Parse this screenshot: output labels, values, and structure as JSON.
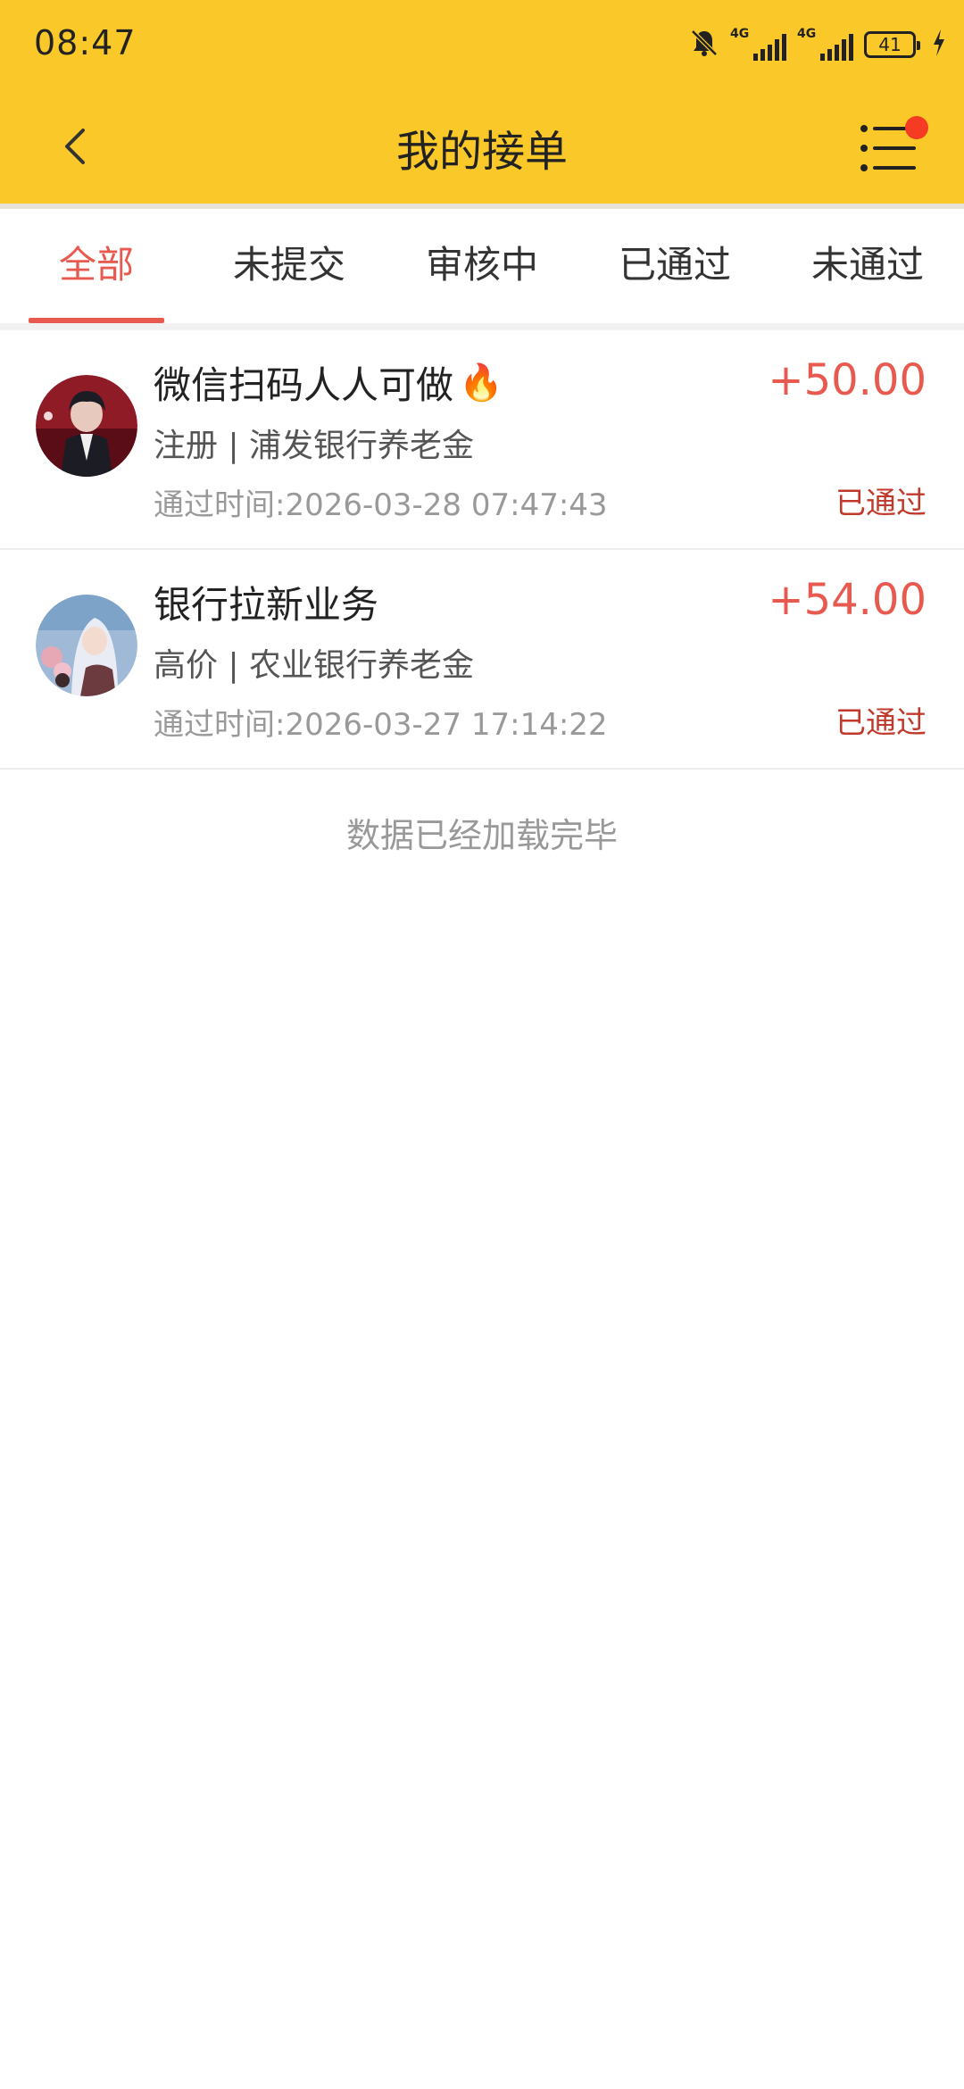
{
  "status_bar": {
    "time": "08:47",
    "network1": "4G",
    "network2": "4G",
    "battery": "41",
    "icons": [
      "bell-off-icon",
      "signal-icon",
      "signal-icon",
      "battery-icon",
      "charging-icon"
    ]
  },
  "header": {
    "title": "我的接单",
    "back_icon": "chevron-left-icon",
    "menu_icon": "list-menu-icon",
    "brand_color": "#fbc82a",
    "badge_color": "#f53b23"
  },
  "tabs": [
    {
      "label": "全部",
      "active": true
    },
    {
      "label": "未提交",
      "active": false
    },
    {
      "label": "审核中",
      "active": false
    },
    {
      "label": "已通过",
      "active": false
    },
    {
      "label": "未通过",
      "active": false
    }
  ],
  "accent_color": "#e85a4f",
  "orders": [
    {
      "title": "微信扫码人人可做",
      "title_icon": "fire-icon",
      "subtitle": "注册 | 浦发银行养老金",
      "time": "通过时间:2026-03-28 07:47:43",
      "amount": "+50.00",
      "status": "已通过"
    },
    {
      "title": "银行拉新业务",
      "subtitle": "高价 | 农业银行养老金",
      "time": "通过时间:2026-03-27 17:14:22",
      "amount": "+54.00",
      "status": "已通过"
    }
  ],
  "footer_text": "数据已经加载完毕"
}
